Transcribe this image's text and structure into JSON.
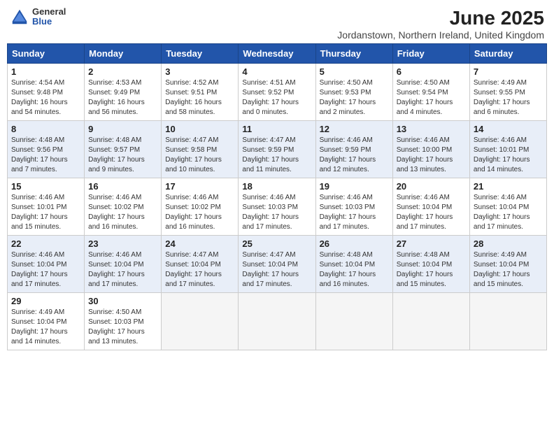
{
  "logo": {
    "general": "General",
    "blue": "Blue"
  },
  "title": "June 2025",
  "subtitle": "Jordanstown, Northern Ireland, United Kingdom",
  "days_of_week": [
    "Sunday",
    "Monday",
    "Tuesday",
    "Wednesday",
    "Thursday",
    "Friday",
    "Saturday"
  ],
  "weeks": [
    [
      {
        "day": "1",
        "info": "Sunrise: 4:54 AM\nSunset: 9:48 PM\nDaylight: 16 hours\nand 54 minutes."
      },
      {
        "day": "2",
        "info": "Sunrise: 4:53 AM\nSunset: 9:49 PM\nDaylight: 16 hours\nand 56 minutes."
      },
      {
        "day": "3",
        "info": "Sunrise: 4:52 AM\nSunset: 9:51 PM\nDaylight: 16 hours\nand 58 minutes."
      },
      {
        "day": "4",
        "info": "Sunrise: 4:51 AM\nSunset: 9:52 PM\nDaylight: 17 hours\nand 0 minutes."
      },
      {
        "day": "5",
        "info": "Sunrise: 4:50 AM\nSunset: 9:53 PM\nDaylight: 17 hours\nand 2 minutes."
      },
      {
        "day": "6",
        "info": "Sunrise: 4:50 AM\nSunset: 9:54 PM\nDaylight: 17 hours\nand 4 minutes."
      },
      {
        "day": "7",
        "info": "Sunrise: 4:49 AM\nSunset: 9:55 PM\nDaylight: 17 hours\nand 6 minutes."
      }
    ],
    [
      {
        "day": "8",
        "info": "Sunrise: 4:48 AM\nSunset: 9:56 PM\nDaylight: 17 hours\nand 7 minutes."
      },
      {
        "day": "9",
        "info": "Sunrise: 4:48 AM\nSunset: 9:57 PM\nDaylight: 17 hours\nand 9 minutes."
      },
      {
        "day": "10",
        "info": "Sunrise: 4:47 AM\nSunset: 9:58 PM\nDaylight: 17 hours\nand 10 minutes."
      },
      {
        "day": "11",
        "info": "Sunrise: 4:47 AM\nSunset: 9:59 PM\nDaylight: 17 hours\nand 11 minutes."
      },
      {
        "day": "12",
        "info": "Sunrise: 4:46 AM\nSunset: 9:59 PM\nDaylight: 17 hours\nand 12 minutes."
      },
      {
        "day": "13",
        "info": "Sunrise: 4:46 AM\nSunset: 10:00 PM\nDaylight: 17 hours\nand 13 minutes."
      },
      {
        "day": "14",
        "info": "Sunrise: 4:46 AM\nSunset: 10:01 PM\nDaylight: 17 hours\nand 14 minutes."
      }
    ],
    [
      {
        "day": "15",
        "info": "Sunrise: 4:46 AM\nSunset: 10:01 PM\nDaylight: 17 hours\nand 15 minutes."
      },
      {
        "day": "16",
        "info": "Sunrise: 4:46 AM\nSunset: 10:02 PM\nDaylight: 17 hours\nand 16 minutes."
      },
      {
        "day": "17",
        "info": "Sunrise: 4:46 AM\nSunset: 10:02 PM\nDaylight: 17 hours\nand 16 minutes."
      },
      {
        "day": "18",
        "info": "Sunrise: 4:46 AM\nSunset: 10:03 PM\nDaylight: 17 hours\nand 17 minutes."
      },
      {
        "day": "19",
        "info": "Sunrise: 4:46 AM\nSunset: 10:03 PM\nDaylight: 17 hours\nand 17 minutes."
      },
      {
        "day": "20",
        "info": "Sunrise: 4:46 AM\nSunset: 10:04 PM\nDaylight: 17 hours\nand 17 minutes."
      },
      {
        "day": "21",
        "info": "Sunrise: 4:46 AM\nSunset: 10:04 PM\nDaylight: 17 hours\nand 17 minutes."
      }
    ],
    [
      {
        "day": "22",
        "info": "Sunrise: 4:46 AM\nSunset: 10:04 PM\nDaylight: 17 hours\nand 17 minutes."
      },
      {
        "day": "23",
        "info": "Sunrise: 4:46 AM\nSunset: 10:04 PM\nDaylight: 17 hours\nand 17 minutes."
      },
      {
        "day": "24",
        "info": "Sunrise: 4:47 AM\nSunset: 10:04 PM\nDaylight: 17 hours\nand 17 minutes."
      },
      {
        "day": "25",
        "info": "Sunrise: 4:47 AM\nSunset: 10:04 PM\nDaylight: 17 hours\nand 17 minutes."
      },
      {
        "day": "26",
        "info": "Sunrise: 4:48 AM\nSunset: 10:04 PM\nDaylight: 17 hours\nand 16 minutes."
      },
      {
        "day": "27",
        "info": "Sunrise: 4:48 AM\nSunset: 10:04 PM\nDaylight: 17 hours\nand 15 minutes."
      },
      {
        "day": "28",
        "info": "Sunrise: 4:49 AM\nSunset: 10:04 PM\nDaylight: 17 hours\nand 15 minutes."
      }
    ],
    [
      {
        "day": "29",
        "info": "Sunrise: 4:49 AM\nSunset: 10:04 PM\nDaylight: 17 hours\nand 14 minutes."
      },
      {
        "day": "30",
        "info": "Sunrise: 4:50 AM\nSunset: 10:03 PM\nDaylight: 17 hours\nand 13 minutes."
      },
      {
        "day": "",
        "info": ""
      },
      {
        "day": "",
        "info": ""
      },
      {
        "day": "",
        "info": ""
      },
      {
        "day": "",
        "info": ""
      },
      {
        "day": "",
        "info": ""
      }
    ]
  ]
}
